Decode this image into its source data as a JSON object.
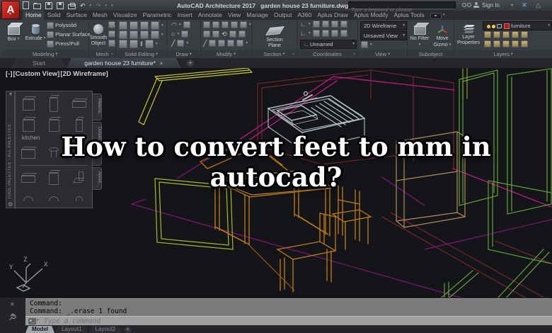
{
  "title_bar": {
    "app_name": "AutoCAD Architecture 2017",
    "document_name": "garden house 23 furniture.dwg",
    "search_placeholder": "Type a keyword or phrase",
    "sign_in": "Sign In"
  },
  "ribbon_tabs": [
    "Home",
    "Solid",
    "Surface",
    "Mesh",
    "Visualize",
    "Parametric",
    "Insert",
    "Annotate",
    "View",
    "Manage",
    "Output",
    "A360",
    "Aplus Draw",
    "Aplus Modify",
    "Aplus Tools"
  ],
  "ribbon": {
    "modeling": {
      "label": "Modeling",
      "box": "Box",
      "extrude": "Extrude",
      "polysolid": "Polysolid",
      "planar_surface": "Planar Surface",
      "press_pull": "Press/Pull"
    },
    "mesh": {
      "label": "Mesh",
      "smooth_object": "Smooth Object"
    },
    "solid_editing": {
      "label": "Solid Editing"
    },
    "draw": {
      "label": "Draw"
    },
    "modify": {
      "label": "Modify"
    },
    "section": {
      "label": "Section",
      "section_plane": "Section Plane"
    },
    "coordinates": {
      "label": "Coordinates",
      "ucs_name": "Unnamed"
    },
    "view": {
      "label": "View",
      "visual_style": "2D Wireframe",
      "named_view": "Unsaved View"
    },
    "subobject": {
      "label": "Subobject",
      "no_filter": "No Filter",
      "move_gizmo": "Move Gizmo"
    },
    "layers": {
      "label": "Layers",
      "layer_properties": "Layer Properties",
      "current_layer": "furniture"
    }
  },
  "file_tabs": {
    "start": "Start",
    "active_doc": "garden house 23 furniture*"
  },
  "viewport_controls": {
    "minimize": "[-]",
    "view_name": "[Custom View]",
    "visual_style": "[2D Wireframe]"
  },
  "tool_palette": {
    "title": "TOOL PALETTES - ALL PALETTES",
    "group": "kitchen",
    "tabs": [
      "Materia..",
      "Details",
      "",
      "Annot.."
    ]
  },
  "headline": {
    "line1": "How to convert feet to mm in",
    "line2": "autocad?"
  },
  "command_line": {
    "lines": [
      "Command:",
      "Command: _.erase 1 found"
    ],
    "placeholder": "Type a command"
  },
  "layout_tabs": [
    "Model",
    "Layout1",
    "Layout2"
  ],
  "ucs_labels": {
    "x": "X",
    "y": "Y",
    "z": "Z"
  },
  "colors": {
    "canvas_bg": "#131519",
    "logo_red": "#d42a22",
    "wire_orange": "#c27c17",
    "wire_green": "#5d9733",
    "wire_magenta": "#b5187d",
    "wire_purple": "#7c1470",
    "wire_yellow": "#c9c92e",
    "wire_darkred": "#6e2430",
    "wire_gray": "#b6bfbf",
    "wire_tan": "#b08d5e",
    "layer_swatch_red": "#b01b1b"
  }
}
